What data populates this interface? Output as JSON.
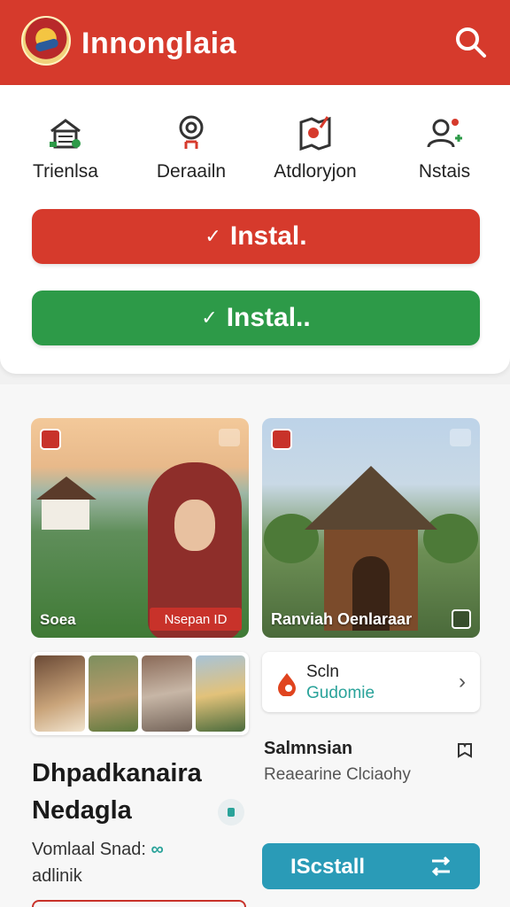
{
  "header": {
    "title": "Innonglaia"
  },
  "categories": [
    {
      "label": "Trienlsa",
      "icon": "building-icon"
    },
    {
      "label": "Deraailn",
      "icon": "location-pin-icon"
    },
    {
      "label": "Atdloryjon",
      "icon": "map-icon"
    },
    {
      "label": "Nstais",
      "icon": "user-group-icon"
    }
  ],
  "buttons": {
    "primary_label": "Instal.",
    "secondary_label": "Instal..",
    "check_glyph": "✓"
  },
  "feed": {
    "photo1": {
      "caption": "Soea",
      "tag": "Nsepan ID"
    },
    "photo2": {
      "caption": "Ranviah Oenlaraar"
    },
    "info_card": {
      "title": "Scln",
      "subtitle": "Gudomie"
    },
    "side": {
      "title": "Salmnsian",
      "subtitle": "Reaearine Clciaohy"
    },
    "article": {
      "title_line1": "Dhpadkanaira",
      "title_line2": "Nedagla",
      "text_line1": "Vomlaal Snad:",
      "text_line2": "adlinik"
    },
    "install": {
      "label": "IScstall"
    }
  },
  "colors": {
    "brand_red": "#d63a2c",
    "green": "#2d9a48",
    "teal": "#2a9bb7"
  }
}
